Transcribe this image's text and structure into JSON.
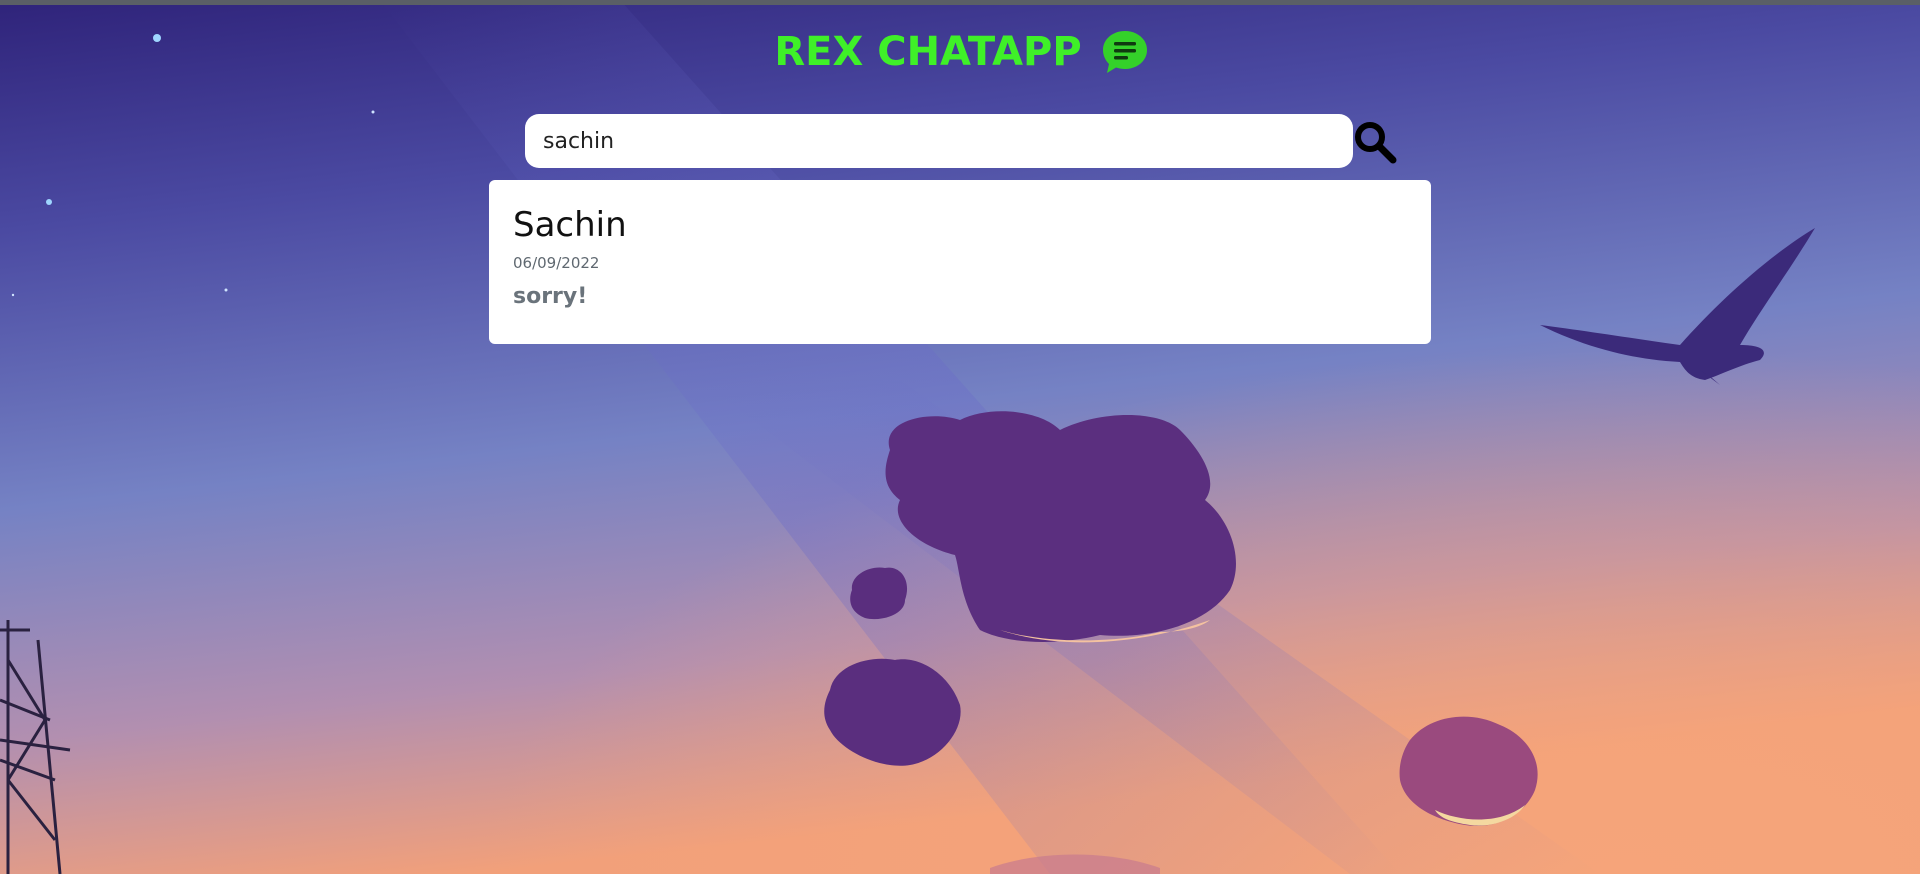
{
  "app": {
    "title": "REX CHATAPP",
    "title_color": "#3ff028",
    "icon": "chat-bubble-icon"
  },
  "search": {
    "value": "sachin",
    "placeholder": "",
    "icon": "search-icon"
  },
  "results": [
    {
      "name": "Sachin",
      "date": "06/09/2022",
      "message": "sorry!"
    }
  ],
  "background": {
    "description_colors": [
      "#352a84",
      "#5b5fb0",
      "#7b86c6",
      "#e8a080"
    ]
  }
}
